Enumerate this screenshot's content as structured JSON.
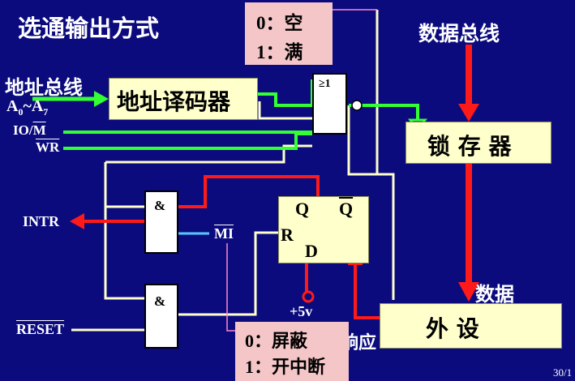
{
  "slide": {
    "title": "选通输出方式",
    "page_number": "30/1"
  },
  "labels": {
    "address_bus": "地址总线",
    "address_range_a": "A",
    "address_sub_0": "0",
    "address_tilde": "~A",
    "address_sub_7": "7",
    "io_m_prefix": "IO/",
    "io_m_suffix": "M",
    "wr": "WR",
    "data_bus": "数据总线",
    "data": "数据",
    "intr": "INTR",
    "mi": "MI",
    "reset": "RESET",
    "plus5v": "+5v",
    "response": "响应"
  },
  "blocks": {
    "address_decoder": "地址译码器",
    "latch": "锁 存 器",
    "peripheral": "外    设",
    "or_gate": "≥1",
    "and_gate_top": "&",
    "and_gate_bottom": "&",
    "flipflop_q": "Q",
    "flipflop_qbar": "Q",
    "flipflop_r": "R",
    "flipflop_d": "D"
  },
  "notes": {
    "status_line1": "0：空",
    "status_line2": "1：满",
    "mask_line1": "0：屏蔽",
    "mask_line2": "1：开中断"
  },
  "colors": {
    "background": "#0b0b7e",
    "box_fill": "#ffffcc",
    "note_fill": "#f4c6c8",
    "bus_red": "#ff1a1a",
    "green_wire": "#33ff33",
    "blue_wire": "#55c8ff",
    "wire_white": "#ffffcc"
  }
}
